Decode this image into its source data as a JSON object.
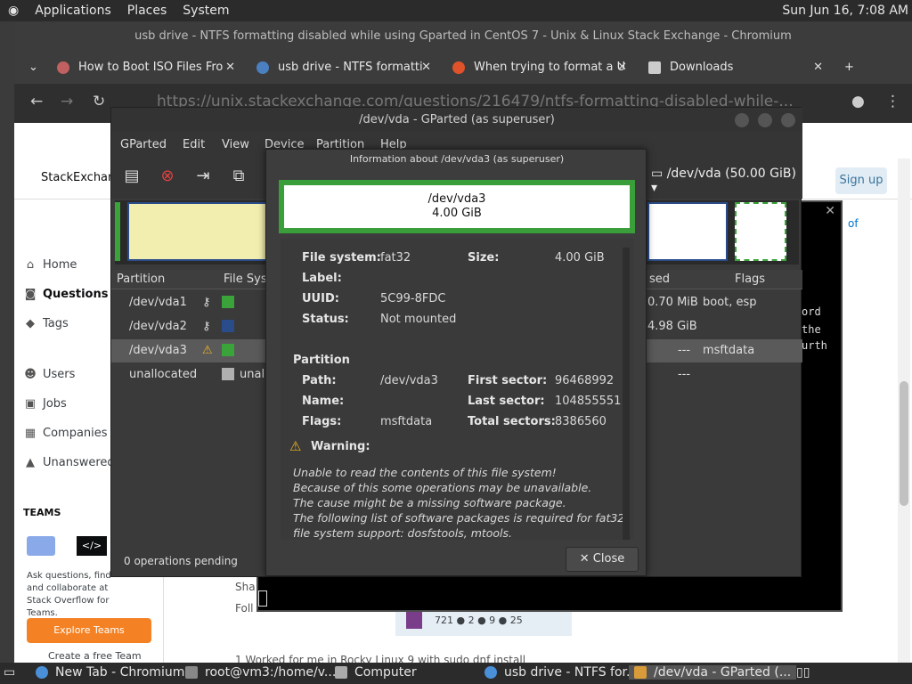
{
  "top_panel": {
    "menus": [
      "Applications",
      "Places",
      "System"
    ],
    "clock": "Sun Jun 16,  7:08 AM"
  },
  "chromium": {
    "title": "usb drive - NTFS formatting disabled while using Gparted in CentOS 7 - Unix & Linux Stack Exchange - Chromium",
    "tabs": [
      {
        "label": "How to Boot ISO Files Fro",
        "close": "✕"
      },
      {
        "label": "usb drive - NTFS formatti",
        "close": "✕"
      },
      {
        "label": "When trying to format a U",
        "close": "✕"
      },
      {
        "label": "Downloads",
        "close": "✕"
      }
    ],
    "new_tab": "+",
    "url": "https://unix.stackexchange.com/questions/216479/ntfs-formatting-disabled-while-..."
  },
  "stackexchange": {
    "logo": "StackExchange",
    "signup": "Sign up",
    "nav": [
      "Home",
      "Questions",
      "Tags",
      "Users",
      "Jobs",
      "Companies",
      "Unanswered"
    ],
    "teams_heading": "TEAMS",
    "teams_text": "Ask questions, find and collaborate at Stack Overflow for Teams.",
    "explore_button": "Explore Teams",
    "create_team": "Create a free Team",
    "frag_sha": "Sha",
    "frag_foll": "Foll",
    "frag_of": "of",
    "user_stats": "721 ● 2 ● 9 ● 25",
    "answer_snippet": "1    Worked for me in Rocky Linux 9 with  sudo dnf install",
    "terminal_lines": [
      "ord",
      "the",
      "urth"
    ]
  },
  "gparted": {
    "title": "/dev/vda - GParted (as superuser)",
    "menus": [
      "GParted",
      "Edit",
      "View",
      "Device",
      "Partition",
      "Help"
    ],
    "device_select": "/dev/vda (50.00 GiB)",
    "columns": [
      "Partition",
      "File Syst",
      "sed",
      "Flags"
    ],
    "rows": [
      {
        "partition": "/dev/vda1",
        "fs": "",
        "used": "0.70 MiB",
        "flags": "boot, esp",
        "color": "#3aa33a"
      },
      {
        "partition": "/dev/vda2",
        "fs": "",
        "used": "4.98 GiB",
        "flags": "",
        "color": "#2a4c8a"
      },
      {
        "partition": "/dev/vda3",
        "fs": "",
        "used": "---",
        "flags": "msftdata",
        "color": "#3aa33a"
      },
      {
        "partition": "unallocated",
        "fs": "unall",
        "used": "---",
        "flags": "",
        "color": "#b0b0b0"
      }
    ],
    "status": "0 operations pending"
  },
  "info_dialog": {
    "title": "Information about /dev/vda3 (as superuser)",
    "partition_name": "/dev/vda3",
    "partition_size": "4.00 GiB",
    "filesystem_section": {
      "file_system_label": "File system:",
      "file_system_value": "fat32",
      "size_label": "Size:",
      "size_value": "4.00 GiB",
      "label_label": "Label:",
      "uuid_label": "UUID:",
      "uuid_value": "5C99-8FDC",
      "status_label": "Status:",
      "status_value": "Not mounted"
    },
    "partition_section": {
      "heading": "Partition",
      "path_label": "Path:",
      "path_value": "/dev/vda3",
      "first_sector_label": "First sector:",
      "first_sector_value": "96468992",
      "name_label": "Name:",
      "last_sector_label": "Last sector:",
      "last_sector_value": "104855551",
      "flags_label": "Flags:",
      "flags_value": "msftdata",
      "total_sectors_label": "Total sectors:",
      "total_sectors_value": "8386560"
    },
    "warning_heading": "Warning:",
    "warning_lines": [
      "Unable to read the contents of this file system!",
      "Because of this some operations may be unavailable.",
      "The cause might be a missing software package.",
      "The following list of software packages is required for fat32",
      "file system support:  dosfstools, mtools."
    ],
    "close_button": "Close"
  },
  "taskbar": {
    "items": [
      "New Tab - Chromium",
      "root@vm3:/home/v...",
      "Computer",
      "usb drive - NTFS for...",
      "/dev/vda - GParted (..."
    ]
  },
  "colors": {
    "accent_green": "#3a9f3a",
    "explore_orange": "#f48225",
    "warning_yellow": "#f0b323"
  }
}
